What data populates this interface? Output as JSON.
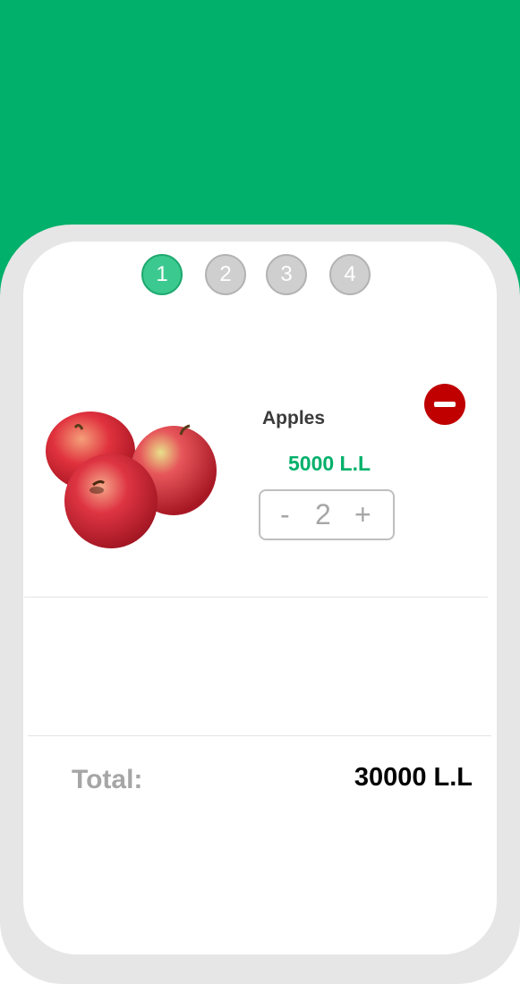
{
  "steps": [
    "1",
    "2",
    "3",
    "4"
  ],
  "active_step": "1",
  "product": {
    "name": "Apples",
    "price": "5000 L.L",
    "quantity": "2",
    "minus_label": "-",
    "plus_label": "+",
    "image": "red-apples-image"
  },
  "remove_icon": "minus-circle-icon",
  "total": {
    "label": "Total:",
    "value": "30000 L.L"
  },
  "colors": {
    "brand_green": "#01b06a",
    "active_step": "#3cc98f",
    "inactive_step": "#cfcfcf",
    "remove_red": "#c00000",
    "card_border": "#e6e6e6"
  }
}
